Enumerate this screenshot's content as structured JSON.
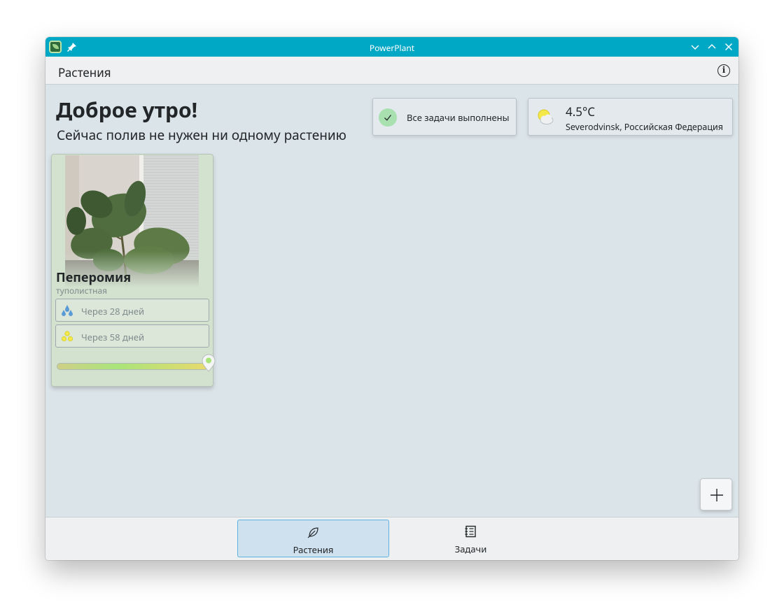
{
  "window": {
    "title": "PowerPlant"
  },
  "header": {
    "page_title": "Растения"
  },
  "greeting": {
    "title": "Доброе утро!",
    "subtitle": "Сейчас полив не нужен ни одному растению"
  },
  "tasks_card": {
    "label": "Все задачи выполнены",
    "icon": "check-icon"
  },
  "weather_card": {
    "temperature": "4.5°C",
    "location": "Severodvinsk, Российская Федерация",
    "icon": "partly-cloudy-icon"
  },
  "plants": [
    {
      "name": "Пеперомия",
      "subname": "туполистная",
      "watering": {
        "text": "Через 28 дней",
        "icon": "water-drops-icon",
        "color": "#5b9bd5"
      },
      "fertilizing": {
        "text": "Через 58 дней",
        "icon": "fertilizer-icon",
        "color": "#f2e94a"
      },
      "health": 1.0
    }
  ],
  "nav": {
    "tabs": [
      {
        "label": "Растения",
        "icon": "leaf-icon",
        "active": true
      },
      {
        "label": "Задачи",
        "icon": "notebook-icon",
        "active": false
      }
    ]
  },
  "colors": {
    "titlebar": "#00a8c6",
    "accent": "#5fb2e0",
    "card_green": "#d3e2cf"
  }
}
